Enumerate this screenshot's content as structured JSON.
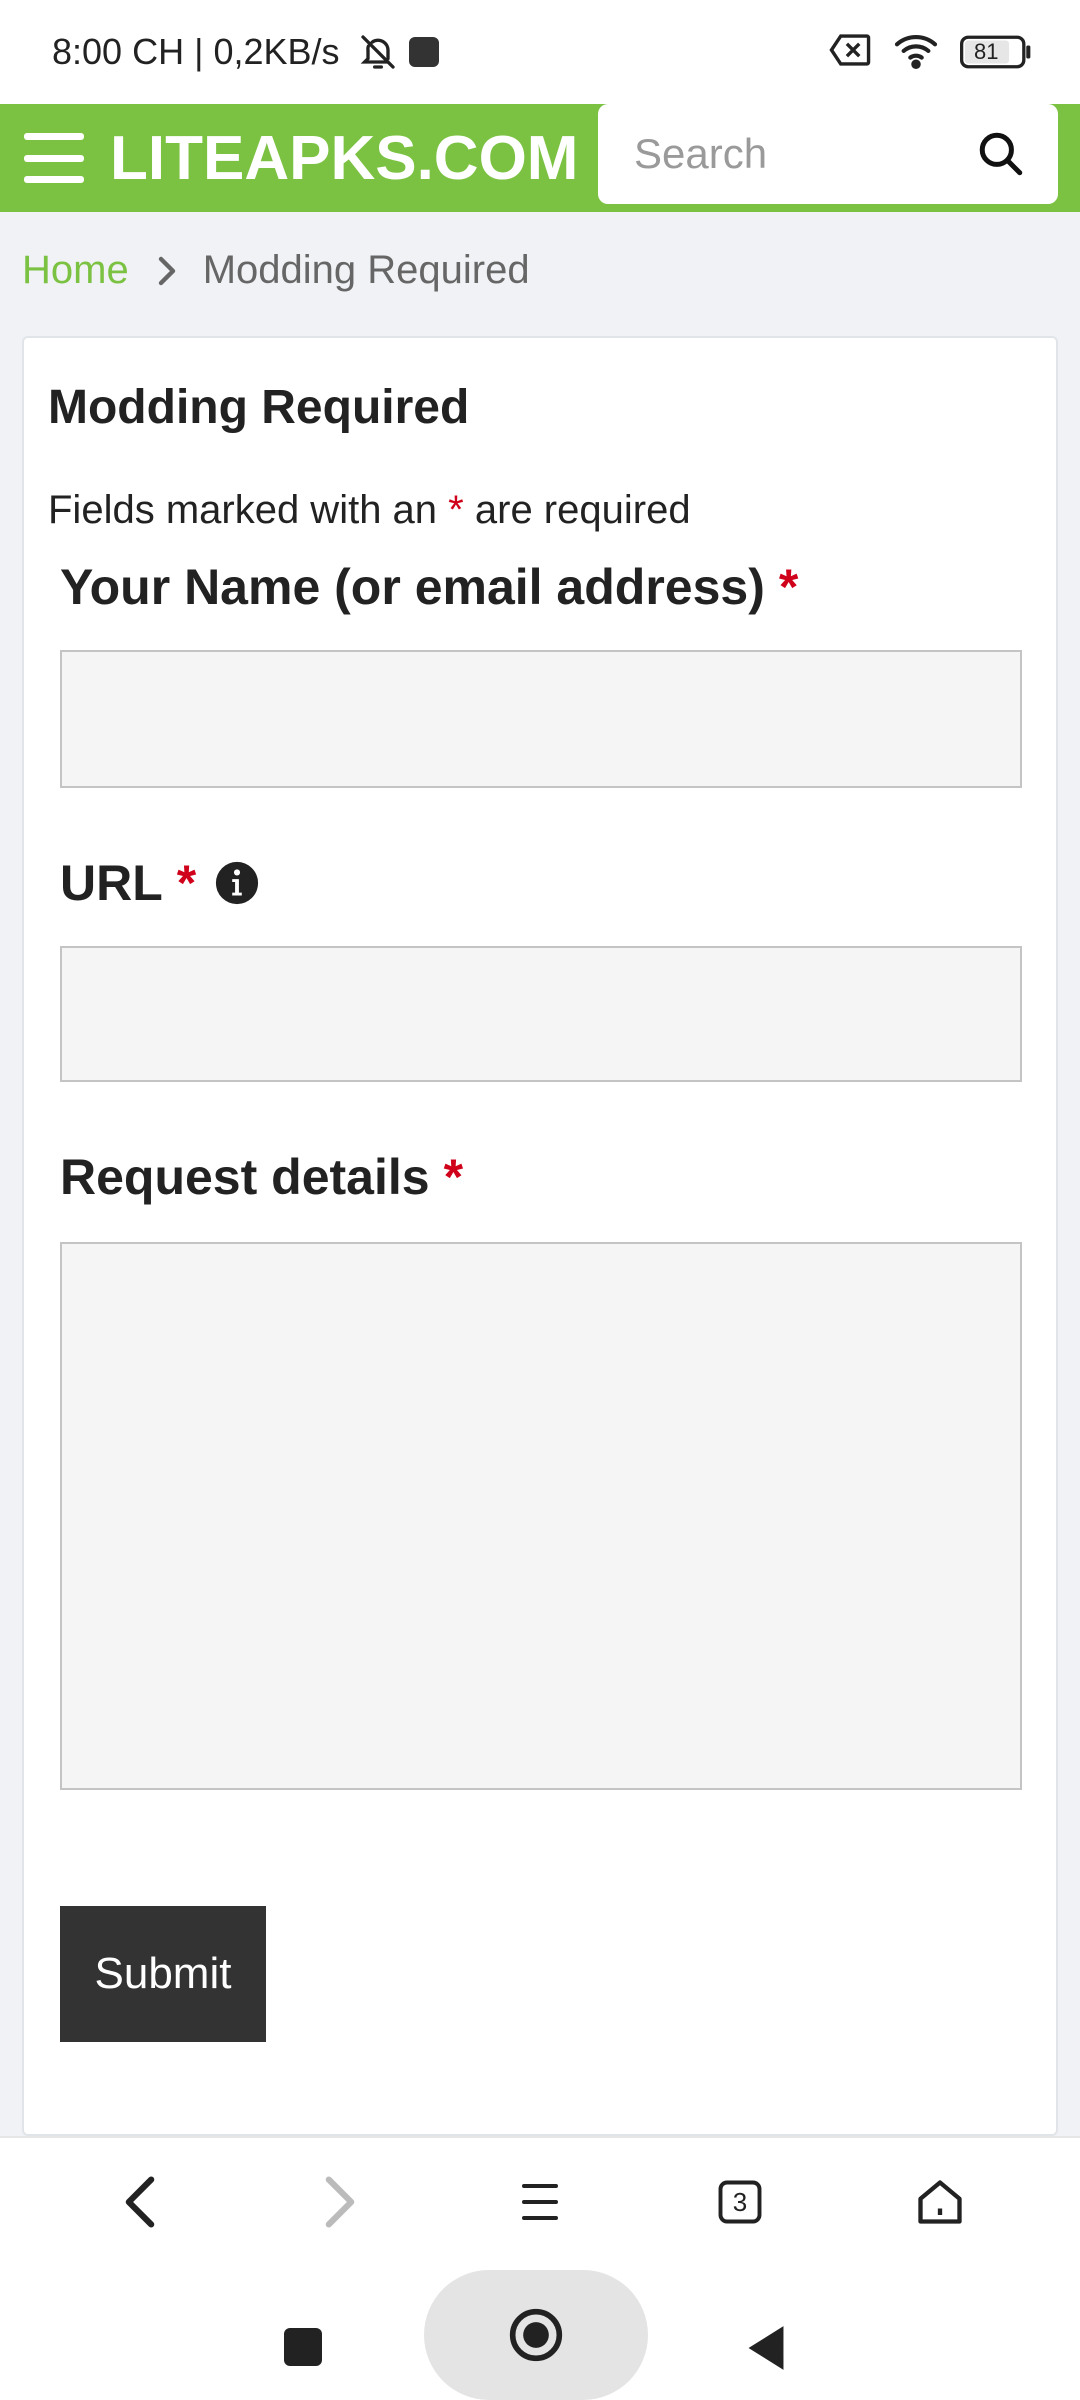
{
  "status_bar": {
    "time": "8:00 CH",
    "separator": "|",
    "speed": "0,2KB/s",
    "battery": "81",
    "icons": [
      "bell-off-icon",
      "app-notification-icon",
      "sim-error-icon",
      "wifi-icon",
      "battery-icon"
    ]
  },
  "header": {
    "logo": "LITEAPKS.COM",
    "search_placeholder": "Search",
    "accent_color": "#7cc242"
  },
  "breadcrumb": {
    "home": "Home",
    "current": "Modding Required"
  },
  "form": {
    "title": "Modding Required",
    "required_note_before": "Fields marked with an",
    "required_marker": "*",
    "required_note_after": "are required",
    "name_label": "Your Name (or email address)",
    "url_label": "URL",
    "details_label": "Request details",
    "name_value": "",
    "url_value": "",
    "details_value": "",
    "submit_label": "Submit"
  },
  "browser_toolbar": {
    "tab_count": "3",
    "icons": [
      "back-icon",
      "forward-icon",
      "menu-icon",
      "tabs-icon",
      "home-icon"
    ]
  }
}
